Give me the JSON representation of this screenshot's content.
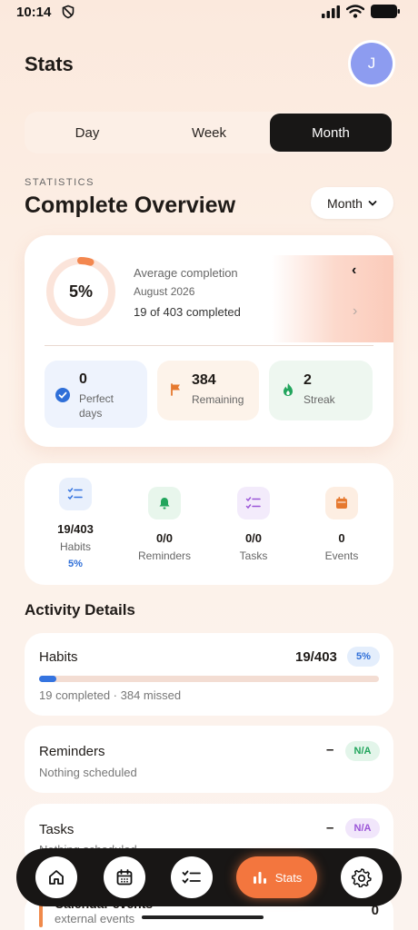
{
  "status": {
    "time": "10:14"
  },
  "header": {
    "title": "Stats",
    "avatar_initial": "J"
  },
  "tabs": {
    "day": "Day",
    "week": "Week",
    "month": "Month",
    "active": "Month"
  },
  "overview": {
    "kicker": "STATISTICS",
    "title": "Complete Overview",
    "period_select": "Month",
    "percent": "5%",
    "percent_value": 0.05,
    "avg_label": "Average completion",
    "date": "August 2026",
    "completed_text": "19 of 403 completed",
    "perfect_days": {
      "value": "0",
      "label_1": "Perfect",
      "label_2": "days"
    },
    "remaining": {
      "value": "384",
      "label": "Remaining"
    },
    "streak": {
      "value": "2",
      "label": "Streak"
    }
  },
  "counts": {
    "habits": {
      "value": "19/403",
      "label": "Habits",
      "pct": "5%"
    },
    "reminders": {
      "value": "0/0",
      "label": "Reminders"
    },
    "tasks": {
      "value": "0/0",
      "label": "Tasks"
    },
    "events": {
      "value": "0",
      "label": "Events"
    }
  },
  "activity": {
    "title": "Activity Details",
    "habits": {
      "name": "Habits",
      "value": "19/403",
      "pill": "5%",
      "progress": 0.05,
      "sub": "19 completed · 384 missed"
    },
    "reminders": {
      "name": "Reminders",
      "value": "–",
      "pill": "N/A",
      "sub": "Nothing scheduled"
    },
    "tasks": {
      "name": "Tasks",
      "value": "–",
      "pill": "N/A",
      "sub": "Nothing scheduled"
    },
    "calendar": {
      "name": "Calendar events",
      "sub": "external events",
      "value": "0"
    }
  },
  "nav": {
    "active_label": "Stats"
  },
  "colors": {
    "accent": "#f3763e",
    "blue": "#3574e0",
    "dark": "#181615"
  }
}
